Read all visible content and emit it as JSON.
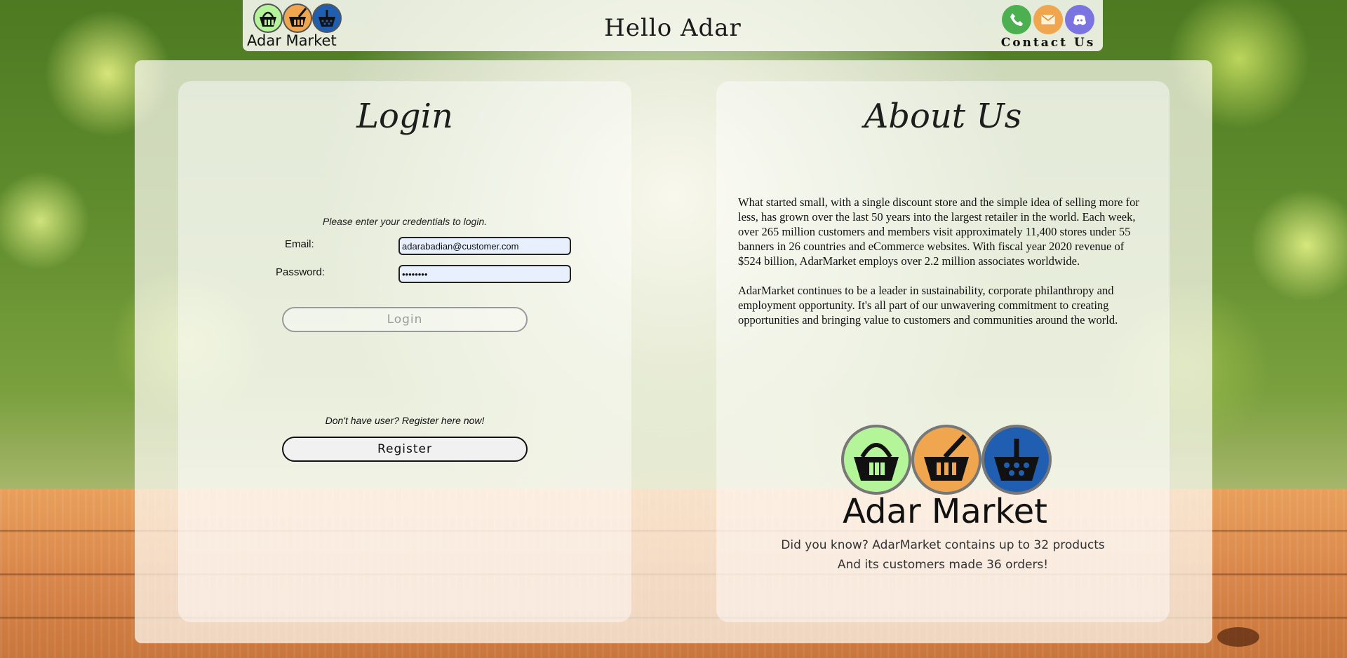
{
  "header": {
    "greeting": "Hello Adar",
    "logo_text": "Adar Market",
    "contact_label": "Contact Us",
    "contact_icons": [
      "phone-icon",
      "mail-icon",
      "discord-icon"
    ]
  },
  "login": {
    "title": "Login",
    "prompt": "Please enter your credentials to login.",
    "email_label": "Email:",
    "email_value": "adarabadian@customer.com",
    "password_label": "Password:",
    "password_value": "••••••••",
    "login_button": "Login",
    "register_prompt": "Don't have user? Register here now!",
    "register_button": "Register"
  },
  "about": {
    "title": "About Us",
    "paragraphs": [
      "What started small, with a single discount store and the simple idea of selling more for less, has grown over the last 50 years into the largest retailer in the world. Each week, over 265 million customers and members visit approximately 11,400 stores under 55 banners in 26 countries and eCommerce websites. With fiscal year 2020 revenue of $524 billion, AdarMarket employs over 2.2 million associates worldwide.",
      "AdarMarket continues to be a leader in sustainability, corporate philanthropy and employment opportunity. It's all part of our unwavering commitment to creating opportunities and bringing value to customers and communities around the world."
    ],
    "logo_text": "Adar Market",
    "fact_line1": "Did you know? AdarMarket contains up to 32 products",
    "fact_line2": "And its customers made 36 orders!"
  },
  "colors": {
    "basket_green": "#b5f59a",
    "basket_orange": "#f0a64f",
    "basket_blue": "#1f5eb0",
    "phone": "#4caf50",
    "mail": "#f0a64f",
    "discord": "#7b74e0"
  }
}
